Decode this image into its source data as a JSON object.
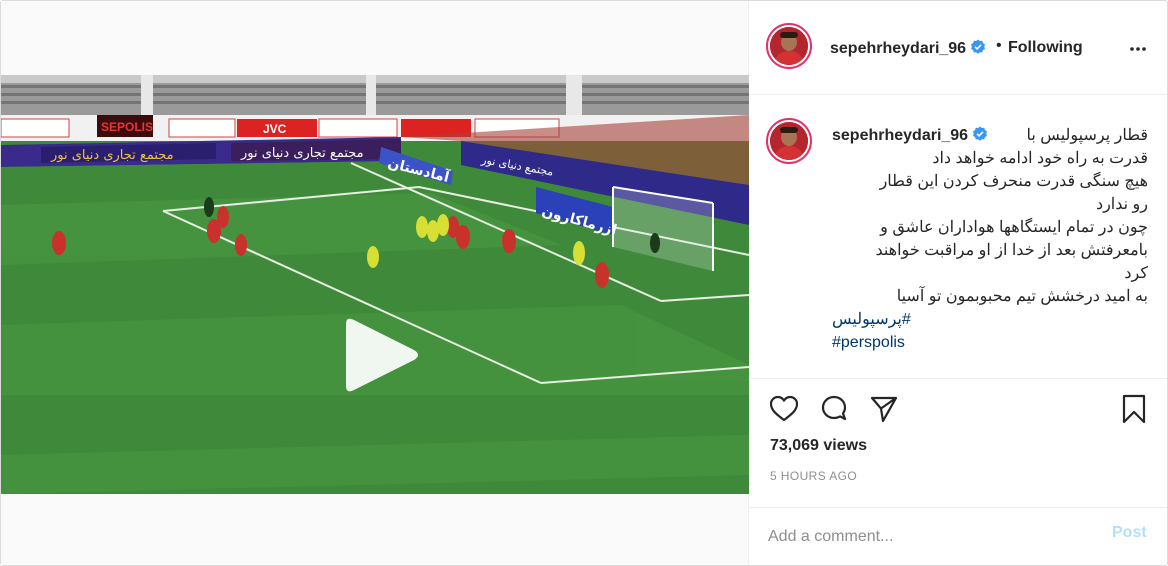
{
  "post": {
    "username": "sepehrheydari_96",
    "verified": true,
    "separator": "•",
    "follow_status": "Following",
    "more_icon": "more-horizontal-icon",
    "video": {
      "play_icon": "play-icon",
      "banners": [
        "جی وی سی",
        "JVC",
        "مجتمع تجاری دنیای نور",
        "ازرماکارون",
        "آمادستان",
        "SEPOLIS"
      ]
    },
    "caption": {
      "lines": [
        "قطار پرسپولیس با",
        "قدرت به راه خود ادامه خواهد داد",
        "هیچ سنگی قدرت منحرف کردن این قطار",
        "رو ندارد",
        "چون در تمام ایستگاهها هواداران عاشق و",
        "بامعرفتش بعد از خدا از او مراقبت خواهند",
        "کرد",
        "به امید درخشش تیم محبوبمون تو آسیا"
      ],
      "hashtags": [
        "#پرسپولیس",
        "#perspolis"
      ]
    },
    "actions": {
      "like_icon": "heart-icon",
      "comment_icon": "comment-icon",
      "share_icon": "share-icon",
      "save_icon": "bookmark-icon"
    },
    "views": "73,069 views",
    "timestamp": "5 HOURS AGO",
    "comment_box": {
      "placeholder": "Add a comment...",
      "post_label": "Post"
    },
    "colors": {
      "verified_blue": "#3897f0",
      "link_blue": "#00376b",
      "post_disabled": "#b2dffc",
      "pitch_green": "#3f8a3a"
    }
  }
}
